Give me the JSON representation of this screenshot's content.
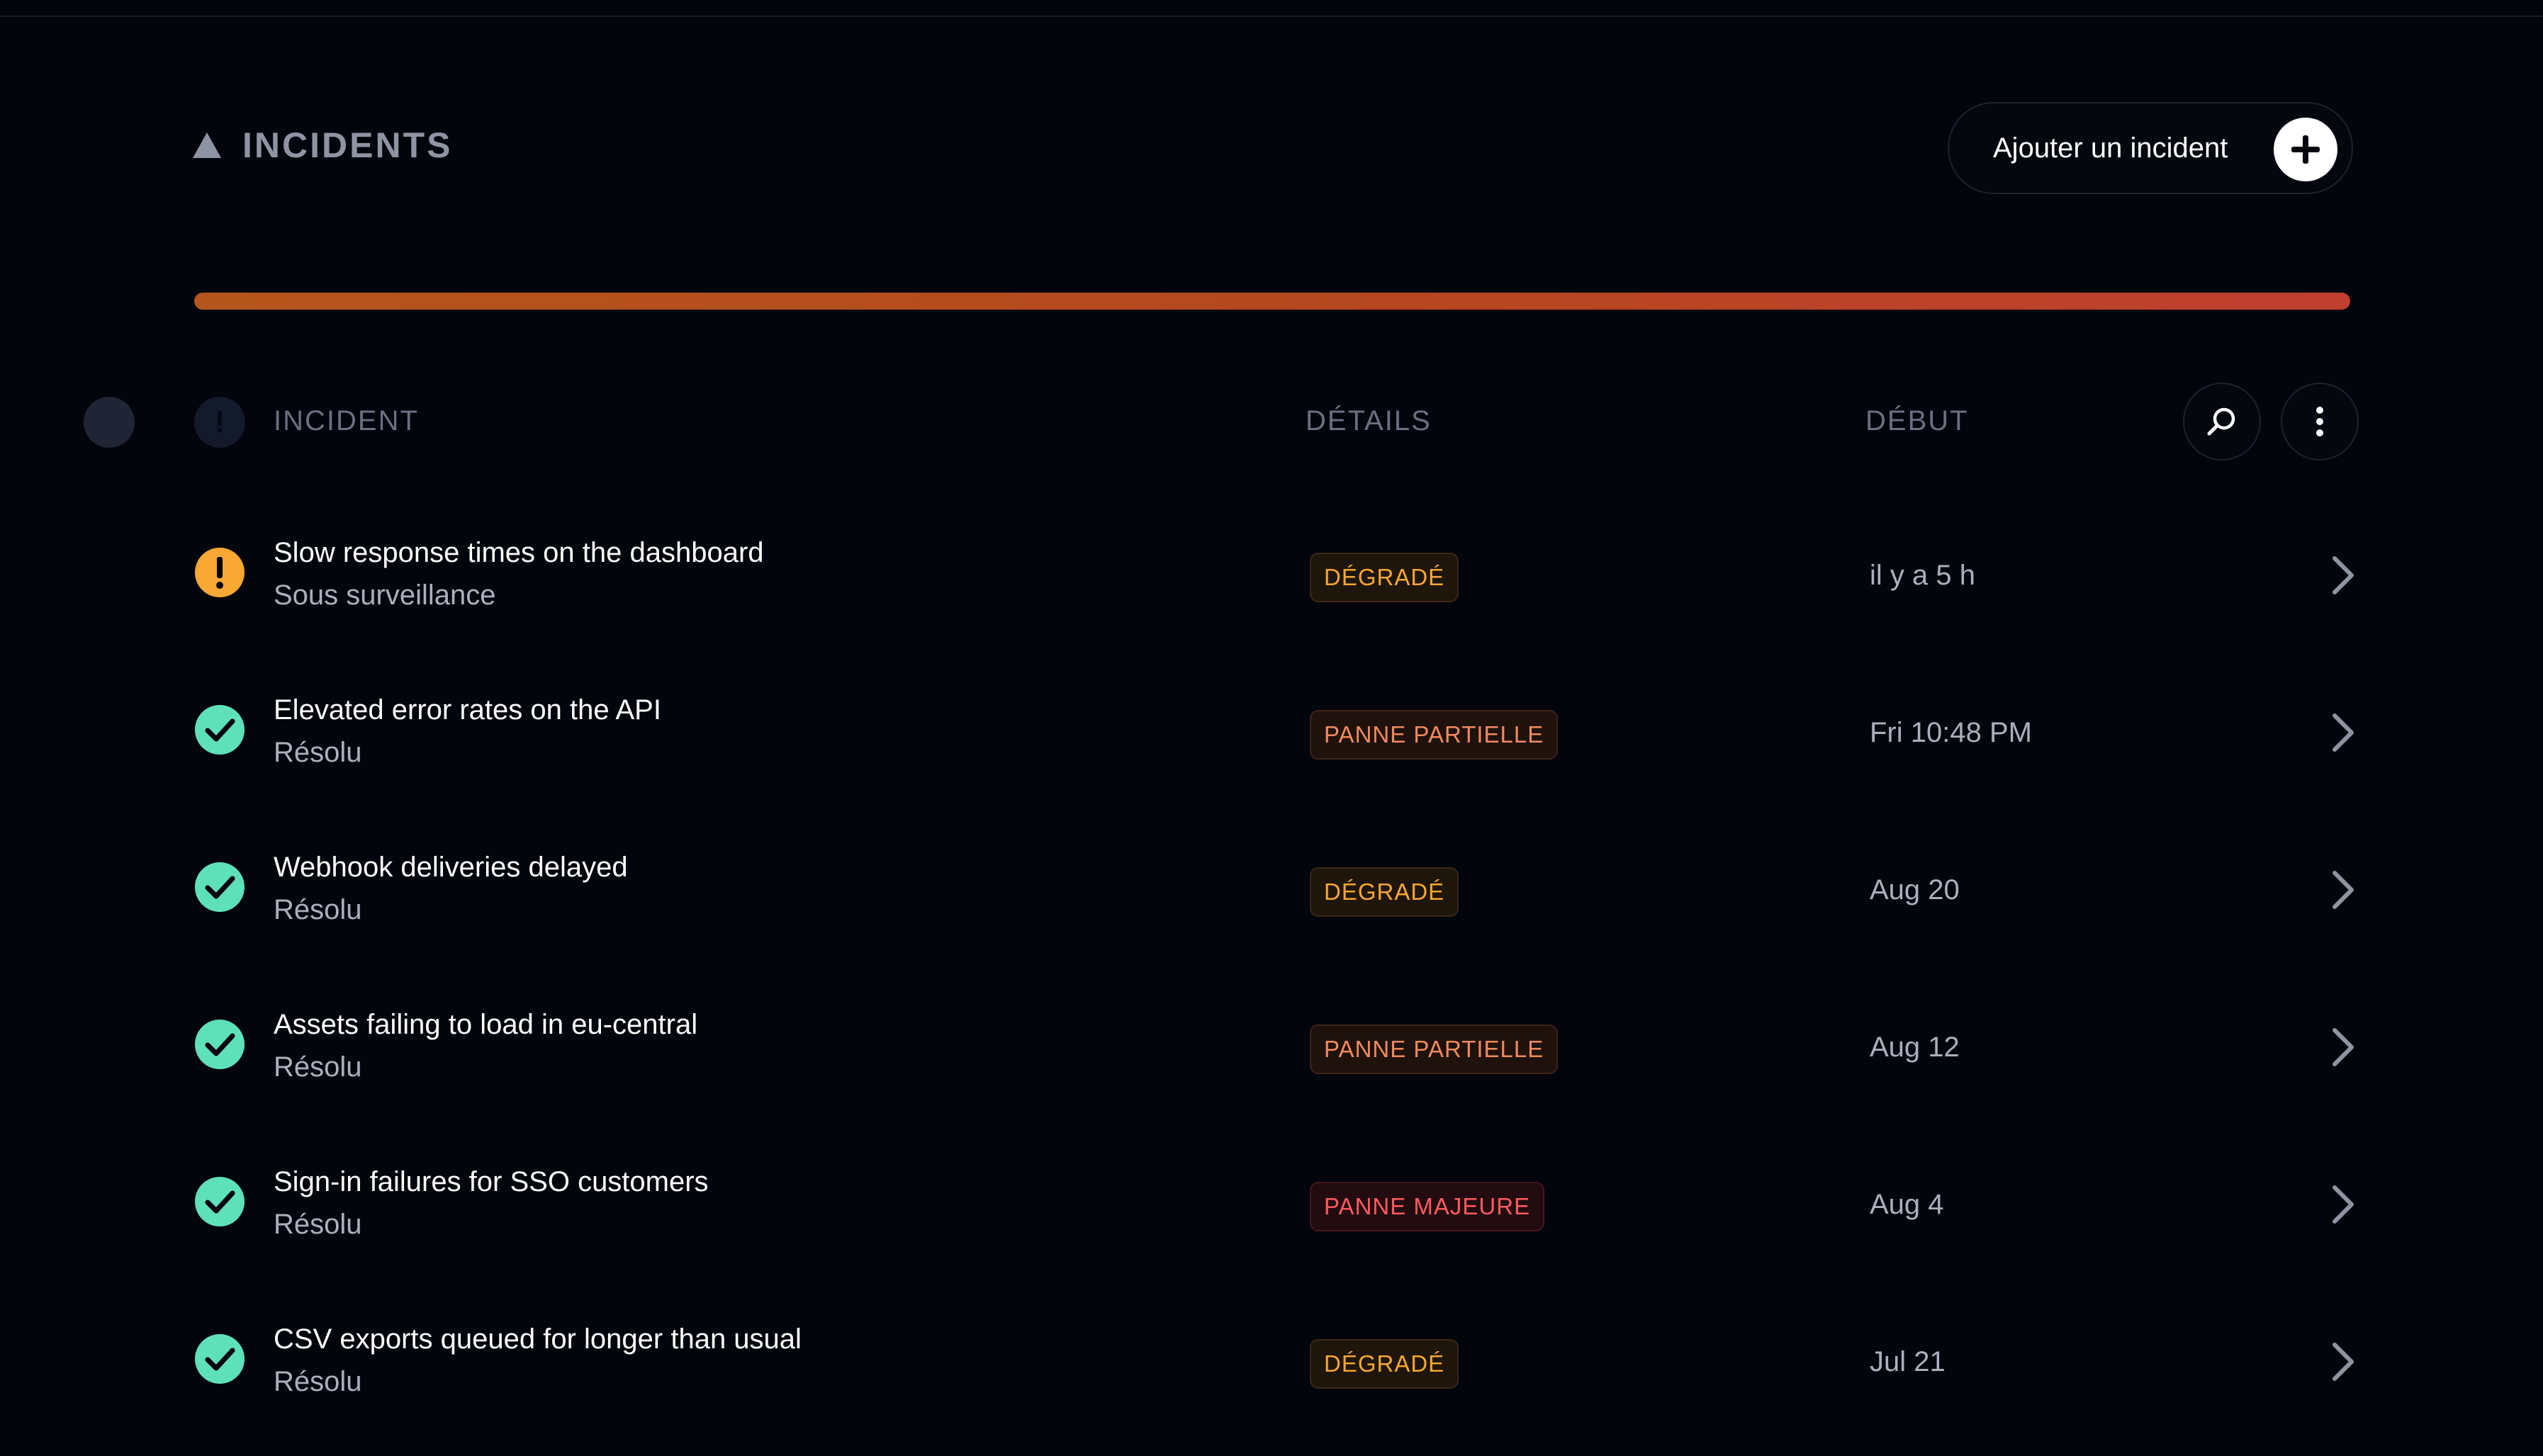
{
  "header": {
    "title": "INCIDENTS",
    "add_button_label": "Ajouter un incident"
  },
  "colors": {
    "background": "#03050d",
    "warning": "#f7a733",
    "resolved": "#5ee0b8",
    "degraded": "#f5a534",
    "partial": "#f08a5e",
    "major": "#ff5a5f"
  },
  "table": {
    "columns": {
      "incident": "INCIDENT",
      "details": "DÉTAILS",
      "start": "DÉBUT"
    },
    "rows": [
      {
        "title": "Slow response times on the dashboard",
        "status": "Sous surveillance",
        "status_icon": "warning-icon",
        "badge": "DÉGRADÉ",
        "badge_kind": "degraded",
        "start": "il y a 5 h"
      },
      {
        "title": "Elevated error rates on the API",
        "status": "Résolu",
        "status_icon": "check-icon",
        "badge": "PANNE PARTIELLE",
        "badge_kind": "partial",
        "start": "Fri 10:48 PM"
      },
      {
        "title": "Webhook deliveries delayed",
        "status": "Résolu",
        "status_icon": "check-icon",
        "badge": "DÉGRADÉ",
        "badge_kind": "degraded",
        "start": "Aug 20"
      },
      {
        "title": "Assets failing to load in eu-central",
        "status": "Résolu",
        "status_icon": "check-icon",
        "badge": "PANNE PARTIELLE",
        "badge_kind": "partial",
        "start": "Aug 12"
      },
      {
        "title": "Sign-in failures for SSO customers",
        "status": "Résolu",
        "status_icon": "check-icon",
        "badge": "PANNE MAJEURE",
        "badge_kind": "major",
        "start": "Aug 4"
      },
      {
        "title": "CSV exports queued for longer than usual",
        "status": "Résolu",
        "status_icon": "check-icon",
        "badge": "DÉGRADÉ",
        "badge_kind": "degraded",
        "start": "Jul 21"
      }
    ]
  }
}
